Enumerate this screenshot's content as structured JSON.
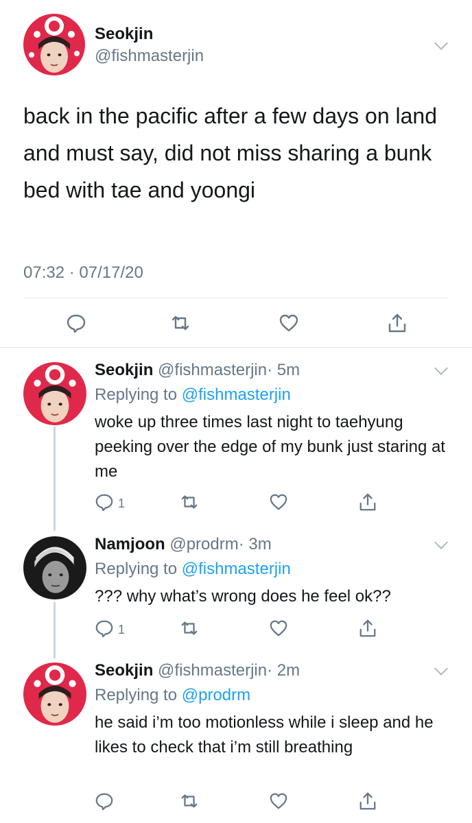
{
  "main_tweet": {
    "display_name": "Seokjin",
    "handle": "@fishmasterjin",
    "text": "back in the pacific after a few days on land and must say, did not miss sharing a bunk bed with tae and yoongi",
    "timestamp": "07:32 · 07/17/20"
  },
  "replies": [
    {
      "display_name": "Seokjin",
      "handle": "@fishmasterjin",
      "age": "· 5m",
      "replying_prefix": "Replying to",
      "replying_to": "@fishmasterjin",
      "text": "woke up three times last night to taehyung peeking over the edge of my bunk just staring at me",
      "reply_count": "1"
    },
    {
      "display_name": "Namjoon",
      "handle": "@prodrm",
      "age": "· 3m",
      "replying_prefix": "Replying to",
      "replying_to": "@fishmasterjin",
      "text": "??? why what’s wrong does he feel ok??",
      "reply_count": "1"
    },
    {
      "display_name": "Seokjin",
      "handle": "@fishmasterjin",
      "age": "· 2m",
      "replying_prefix": "Replying to",
      "replying_to": "@prodrm",
      "text": "he said i’m too motionless while i sleep and he likes to check that i’m still breathing",
      "reply_count": ""
    }
  ],
  "colors": {
    "text": "#14171a",
    "secondary": "#657786",
    "link": "#1da1f2",
    "divider": "#e1e8ed",
    "avatar_hat": "#e0294a"
  },
  "icons": [
    "chevron-down-icon",
    "reply-icon",
    "retweet-icon",
    "like-icon",
    "share-icon"
  ]
}
